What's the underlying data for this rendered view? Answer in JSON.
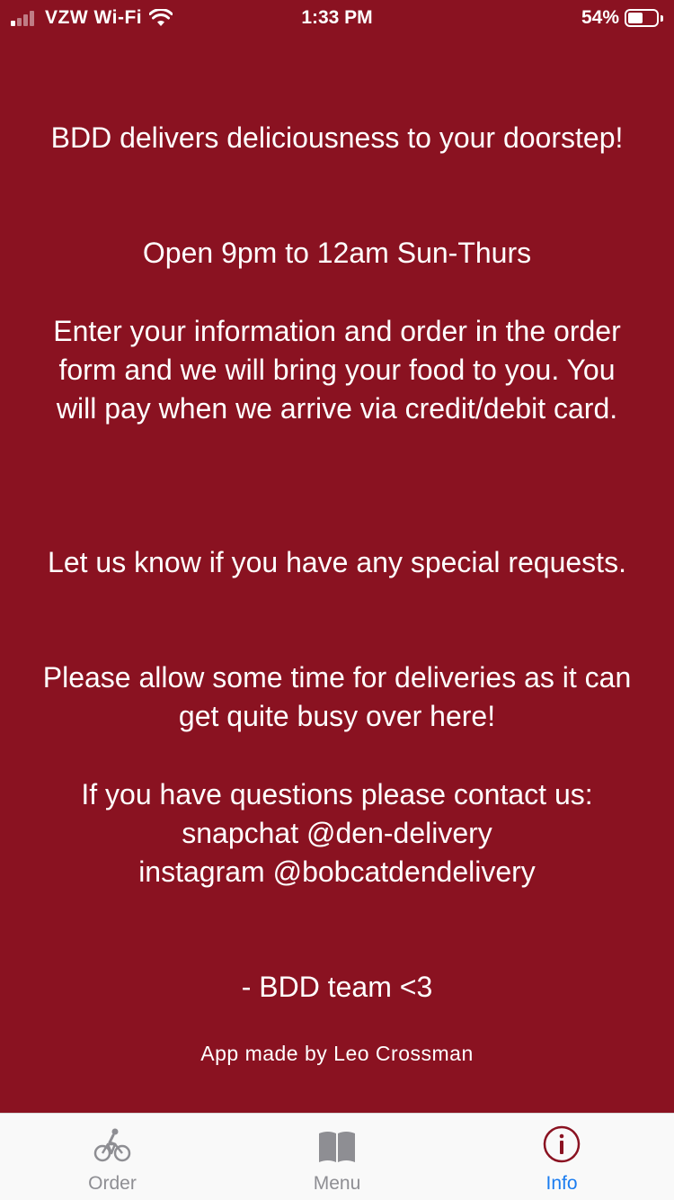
{
  "status_bar": {
    "carrier": "VZW Wi-Fi",
    "time": "1:33 PM",
    "battery": "54%",
    "battery_level": 0.54
  },
  "info": {
    "headline": "BDD delivers deliciousness to your doorstep!",
    "hours": "Open 9pm to 12am Sun-Thurs",
    "instructions": "Enter your information and order in the order form and we will bring your food to you. You will pay when we arrive via credit/debit card.",
    "special_requests": "Let us know if you have any special requests.",
    "patience_note": "Please allow some time for deliveries as it can get quite busy over here!",
    "contact_intro": "If you have questions please contact us:",
    "snapchat": "snapchat @den-delivery",
    "instagram": "instagram @bobcatdendelivery",
    "signoff": "- BDD team <3",
    "credit": "App made by Leo Crossman"
  },
  "tab_bar": {
    "tabs": [
      {
        "label": "Order",
        "icon": "bicycle-icon",
        "active": false
      },
      {
        "label": "Menu",
        "icon": "book-icon",
        "active": false
      },
      {
        "label": "Info",
        "icon": "info-icon",
        "active": true
      }
    ]
  },
  "colors": {
    "background": "#8a1221",
    "text": "#ffffff",
    "tab_active": "#1a7cf0",
    "tab_inactive": "#8e8e93",
    "info_icon": "#8a1221"
  }
}
